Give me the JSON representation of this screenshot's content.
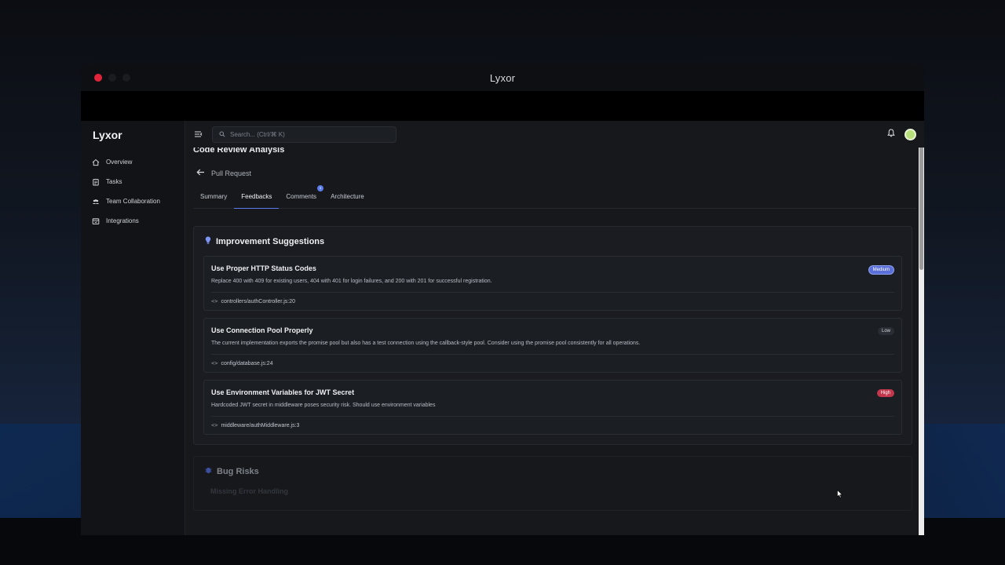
{
  "window": {
    "title": "Lyxor"
  },
  "sidebar": {
    "brand": "Lyxor",
    "items": [
      {
        "label": "Overview",
        "icon": "home-icon"
      },
      {
        "label": "Tasks",
        "icon": "clipboard-icon"
      },
      {
        "label": "Team Collaboration",
        "icon": "team-icon"
      },
      {
        "label": "Integrations",
        "icon": "integrations-icon"
      }
    ]
  },
  "topbar": {
    "search_placeholder": "Search... (Ctrl/⌘ K)"
  },
  "page": {
    "title": "Code Review Analysis",
    "back_label": "Pull Request",
    "tabs": [
      {
        "label": "Summary"
      },
      {
        "label": "Feedbacks",
        "active": true
      },
      {
        "label": "Comments",
        "badge": "9"
      },
      {
        "label": "Architecture"
      }
    ]
  },
  "improvements": {
    "heading": "Improvement Suggestions",
    "items": [
      {
        "title": "Use Proper HTTP Status Codes",
        "severity": "Medium",
        "description": "Replace 400 with 409 for existing users, 404 with 401 for login failures, and 200 with 201 for successful registration.",
        "file": "controllers/authController.js:20"
      },
      {
        "title": "Use Connection Pool Properly",
        "severity": "Low",
        "description": "The current implementation exports the promise pool but also has a test connection using the callback-style pool. Consider using the promise pool consistently for all operations.",
        "file": "config/database.js:24"
      },
      {
        "title": "Use Environment Variables for JWT Secret",
        "severity": "High",
        "description": "Hardcoded JWT secret in middleware poses security risk. Should use environment variables",
        "file": "middleware/authMiddleware.js:3"
      }
    ]
  },
  "bug_risks": {
    "heading": "Bug Risks",
    "first_item": "Missing Error Handling"
  },
  "colors": {
    "accent": "#5b7bea",
    "severity_medium": "#5b6fd8",
    "severity_high": "#c2374c",
    "severity_low": "#2a2d33"
  }
}
